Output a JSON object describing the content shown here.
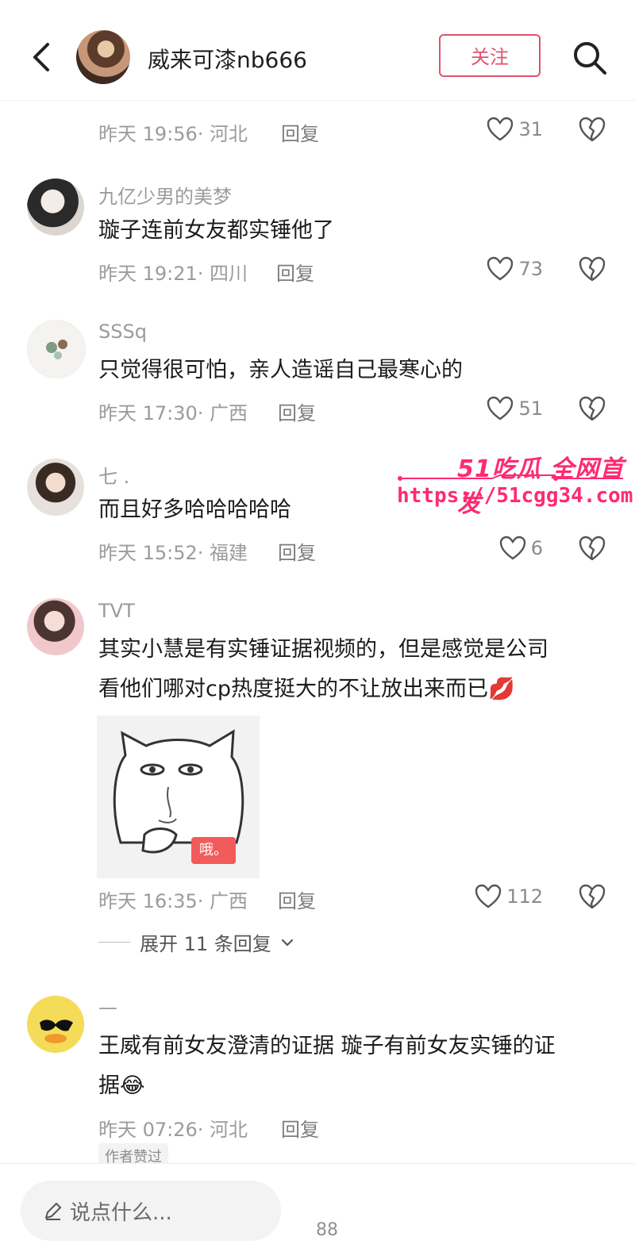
{
  "header": {
    "username": "威来可漆nb666",
    "follow_label": "关注"
  },
  "comments": [
    {
      "username": "",
      "text": "",
      "time_location": "昨天 19:56· 河北",
      "reply_label": "回复",
      "likes": "31"
    },
    {
      "username": "九亿少男的美梦",
      "text": "璇子连前女友都实锤他了",
      "time_location": "昨天 19:21· 四川",
      "reply_label": "回复",
      "likes": "73"
    },
    {
      "username": "SSSq",
      "text": "只觉得很可怕，亲人造谣自己最寒心的",
      "time_location": "昨天 17:30· 广西",
      "reply_label": "回复",
      "likes": "51"
    },
    {
      "username": "七 .",
      "text": "而且好多哈哈哈哈哈",
      "time_location": "昨天 15:52· 福建",
      "reply_label": "回复",
      "likes": "6"
    },
    {
      "username": "TVT",
      "text_line1": "其实小慧是有实锤证据视频的，但是感觉是公司",
      "text_line2": "看他们哪对cp热度挺大的不让放出来而已💋",
      "sticker_label": "哦。",
      "time_location": "昨天 16:35· 广西",
      "reply_label": "回复",
      "likes": "112",
      "expand_label": "展开 11 条回复"
    },
    {
      "username": "—",
      "text_line1": "王威有前女友澄清的证据 璇子有前女友实锤的证",
      "text_line2": "据😂",
      "time_location": "昨天 07:26· 河北",
      "reply_label": "回复",
      "author_tag": "作者赞过"
    }
  ],
  "watermark": {
    "line1": "51吃瓜 全网首发",
    "line2": "https://51cgg34.com"
  },
  "bottom": {
    "placeholder": "说点什么...",
    "blurred_count": "88"
  },
  "colors": {
    "accent": "#e0526e",
    "watermark": "#ff2a70"
  }
}
